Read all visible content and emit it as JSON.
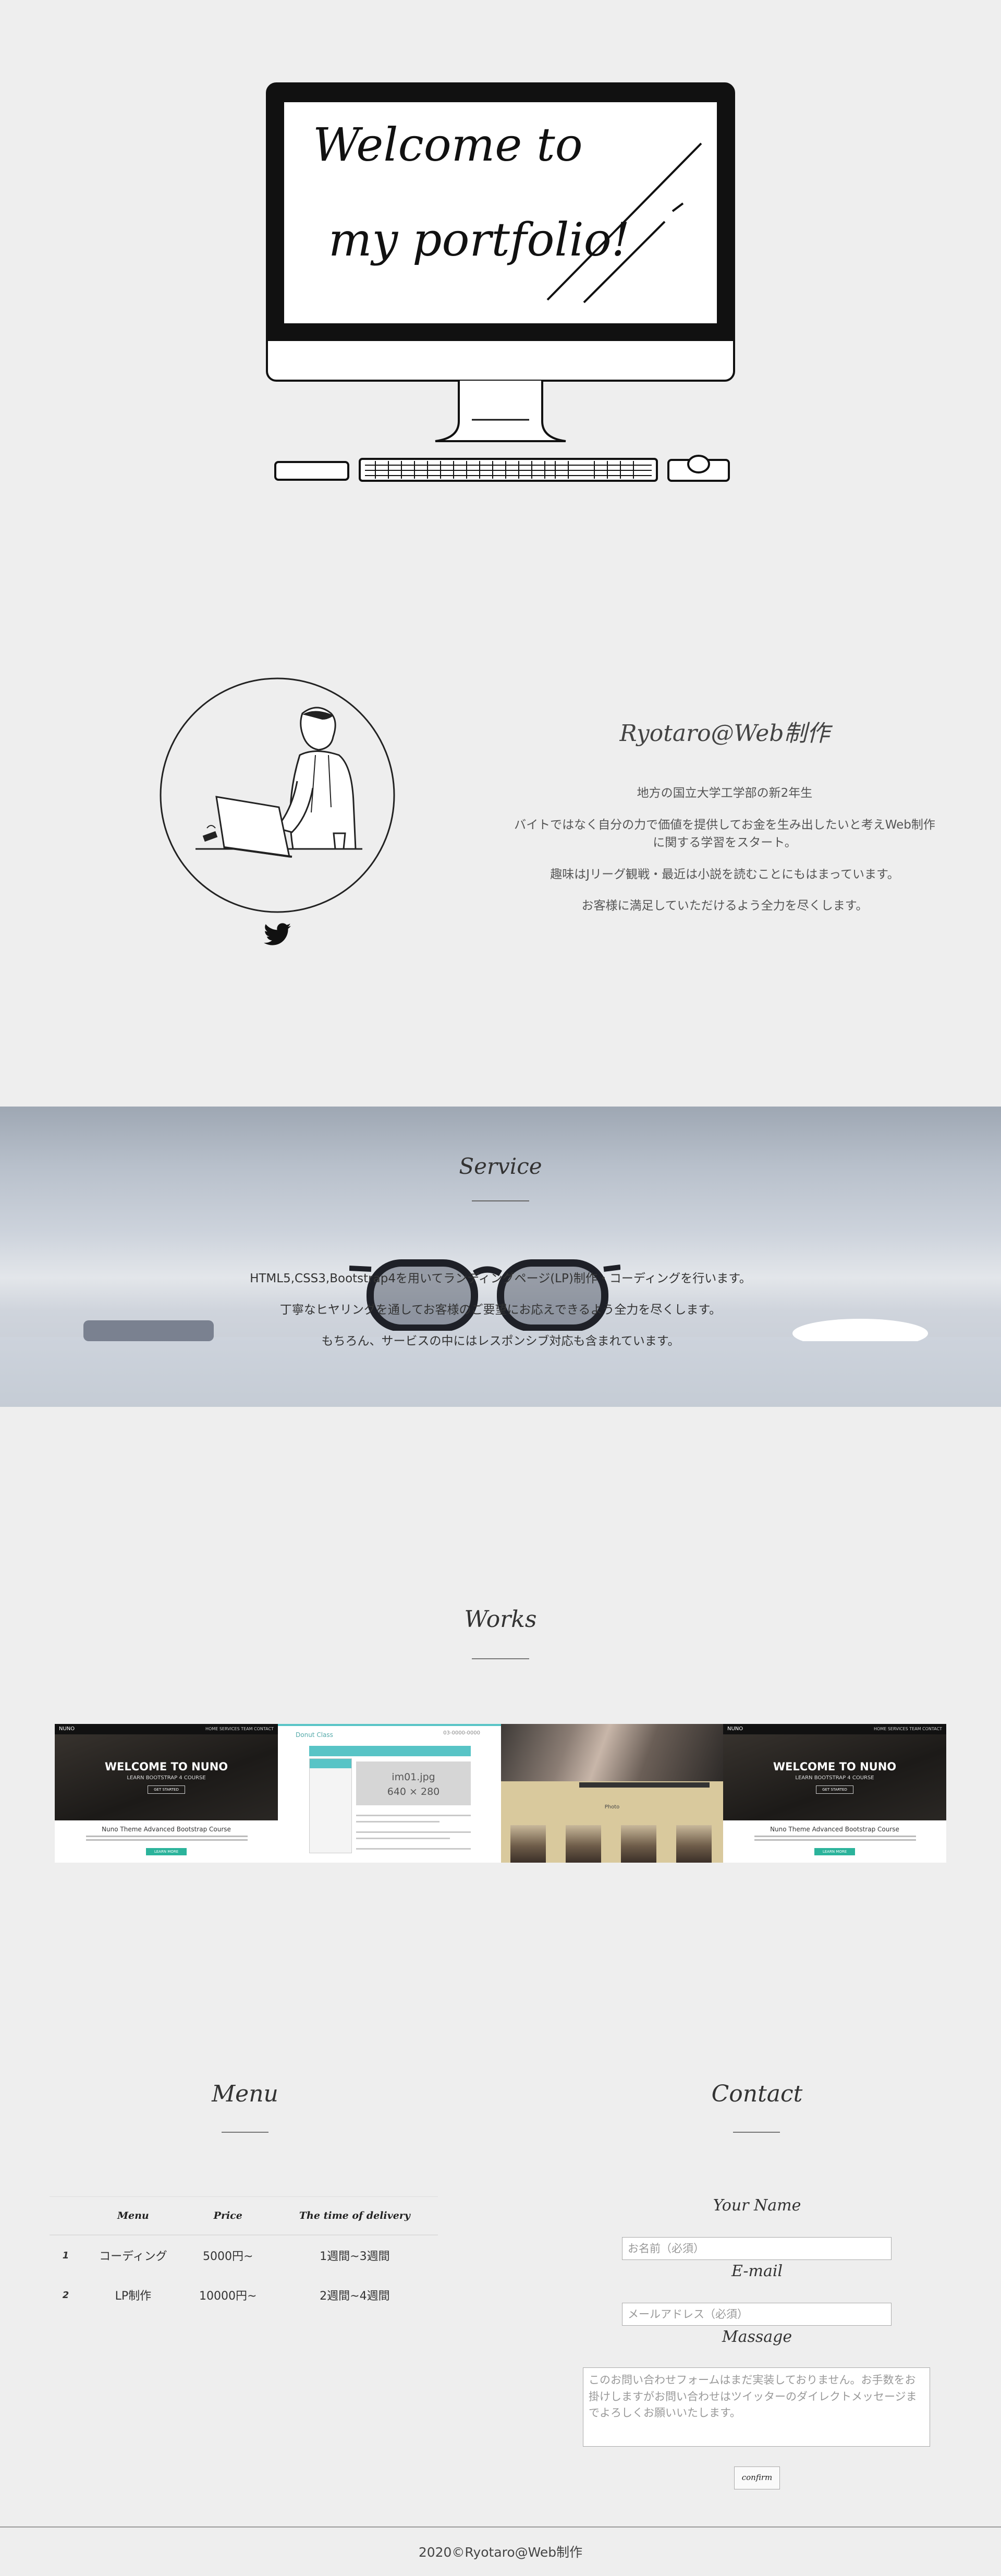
{
  "hero": {
    "screen_line1": "Welcome to",
    "screen_line2": "my portfolio!"
  },
  "profile": {
    "name": "Ryotaro@Web制作",
    "lines": [
      "地方の国立大学工学部の新2年生",
      "バイトではなく自分の力で価値を提供してお金を生み出したいと考えWeb制作に関する学習をスタート。",
      "趣味はJリーグ観戦・最近は小説を読むことにもはまっています。",
      "お客様に満足していただけるよう全力を尽くします。"
    ],
    "twitter_icon": "twitter-icon"
  },
  "service": {
    "title": "Service",
    "lines": [
      "HTML5,CSS3,Bootstrap4を用いてランディングページ(LP)制作・コーディングを行います。",
      "丁寧なヒヤリングを通してお客様のご要望にお応えできるよう全力を尽くします。",
      "もちろん、サービスの中にはレスポンシブ対応も含まれています。"
    ]
  },
  "works": {
    "title": "Works",
    "nuno": {
      "logo": "NUNO",
      "nav": "HOME  SERVICES  TEAM  CONTACT",
      "headline": "WELCOME TO NUNO",
      "sub": "LEARN BOOTSTRAP 4 COURSE",
      "button": "GET STARTED",
      "heading2": "Nuno Theme Advanced Bootstrap Course",
      "cta": "LEARN MORE"
    },
    "donut": {
      "logo": "Donut Class",
      "tel": "03-0000-0000",
      "img_line1": "im01.jpg",
      "img_line2": "640 × 280"
    },
    "photo": {
      "caption": "Photo"
    }
  },
  "menu": {
    "title": "Menu",
    "headers": [
      "Menu",
      "Price",
      "The time of delivery"
    ],
    "rows": [
      {
        "idx": "1",
        "name": "コーディング",
        "price": "5000円~",
        "time": "1週間~3週間"
      },
      {
        "idx": "2",
        "name": "LP制作",
        "price": "10000円~",
        "time": "2週間~4週間"
      }
    ]
  },
  "contact": {
    "title": "Contact",
    "name_label": "Your Name",
    "name_placeholder": "お名前（必須）",
    "email_label": "E-mail",
    "email_placeholder": "メールアドレス（必須）",
    "message_label": "Massage",
    "message_placeholder": "このお問い合わせフォームはまだ実装しておりません。お手数をお掛けしますがお問い合わせはツイッターのダイレクトメッセージまでよろしくお願いいたします。",
    "submit_label": "confirm"
  },
  "footer": {
    "text": "2020©Ryotaro@Web制作"
  }
}
